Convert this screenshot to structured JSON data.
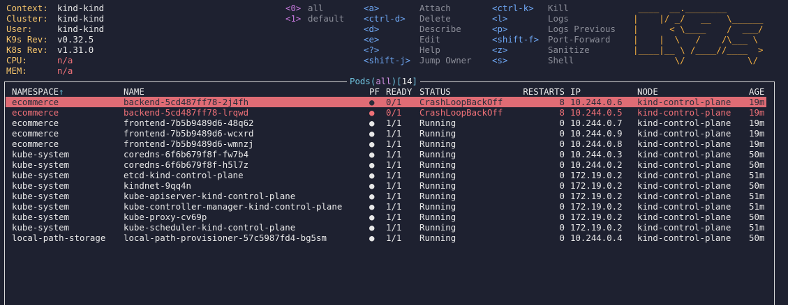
{
  "info": [
    {
      "label": "Context:",
      "value": "kind-kind"
    },
    {
      "label": "Cluster:",
      "value": "kind-kind"
    },
    {
      "label": "User:",
      "value": "kind-kind"
    },
    {
      "label": "K9s Rev:",
      "value": "v0.32.5"
    },
    {
      "label": "K8s Rev:",
      "value": "v1.31.0"
    },
    {
      "label": "CPU:",
      "value": "n/a"
    },
    {
      "label": "MEM:",
      "value": "n/a"
    }
  ],
  "namespaces": [
    {
      "key": "<0>",
      "name": "all"
    },
    {
      "key": "<1>",
      "name": "default"
    }
  ],
  "hotkeys": [
    {
      "key": "<a>",
      "action": "Attach"
    },
    {
      "key": "<ctrl-d>",
      "action": "Delete"
    },
    {
      "key": "<d>",
      "action": "Describe"
    },
    {
      "key": "<e>",
      "action": "Edit"
    },
    {
      "key": "<?>",
      "action": "Help"
    },
    {
      "key": "<shift-j>",
      "action": "Jump Owner"
    },
    {
      "key": "<ctrl-k>",
      "action": "Kill"
    },
    {
      "key": "<l>",
      "action": "Logs"
    },
    {
      "key": "<p>",
      "action": "Logs Previous"
    },
    {
      "key": "<shift-f>",
      "action": "Port-Forward"
    },
    {
      "key": "<z>",
      "action": "Sanitize"
    },
    {
      "key": "<s>",
      "action": "Shell"
    }
  ],
  "logo": [
    " ____  __.________       ",
    "|    |/ _/   __   \\______",
    "|      < \\____    /  ___/",
    "|    |  \\   /    /\\___ \\ ",
    "|____|__ \\ /____//____  >",
    "        \\/            \\/ "
  ],
  "view": {
    "resource": "Pods",
    "filter": "all",
    "count": "14"
  },
  "table": {
    "headers": {
      "namespace": "NAMESPACE",
      "sort_indicator": "↑",
      "name": "NAME",
      "pf": "PF",
      "ready": "READY",
      "status": "STATUS",
      "restarts": "RESTARTS",
      "ip": "IP",
      "node": "NODE",
      "age": "AGE"
    },
    "rows": [
      {
        "namespace": "ecommerce",
        "name": "backend-5cd487ff78-2j4fh",
        "pf": "●",
        "ready": "0/1",
        "status": "CrashLoopBackOff",
        "restarts": "8",
        "ip": "10.244.0.6",
        "node": "kind-control-plane",
        "age": "19m",
        "state": "selected"
      },
      {
        "namespace": "ecommerce",
        "name": "backend-5cd487ff78-lrqwd",
        "pf": "●",
        "ready": "0/1",
        "status": "CrashLoopBackOff",
        "restarts": "8",
        "ip": "10.244.0.5",
        "node": "kind-control-plane",
        "age": "19m",
        "state": "error"
      },
      {
        "namespace": "ecommerce",
        "name": "frontend-7b5b9489d6-48q62",
        "pf": "●",
        "ready": "1/1",
        "status": "Running",
        "restarts": "0",
        "ip": "10.244.0.7",
        "node": "kind-control-plane",
        "age": "19m",
        "state": "ok"
      },
      {
        "namespace": "ecommerce",
        "name": "frontend-7b5b9489d6-wcxrd",
        "pf": "●",
        "ready": "1/1",
        "status": "Running",
        "restarts": "0",
        "ip": "10.244.0.9",
        "node": "kind-control-plane",
        "age": "19m",
        "state": "ok"
      },
      {
        "namespace": "ecommerce",
        "name": "frontend-7b5b9489d6-wmnzj",
        "pf": "●",
        "ready": "1/1",
        "status": "Running",
        "restarts": "0",
        "ip": "10.244.0.8",
        "node": "kind-control-plane",
        "age": "19m",
        "state": "ok"
      },
      {
        "namespace": "kube-system",
        "name": "coredns-6f6b679f8f-fw7b4",
        "pf": "●",
        "ready": "1/1",
        "status": "Running",
        "restarts": "0",
        "ip": "10.244.0.3",
        "node": "kind-control-plane",
        "age": "50m",
        "state": "ok"
      },
      {
        "namespace": "kube-system",
        "name": "coredns-6f6b679f8f-h5l7z",
        "pf": "●",
        "ready": "1/1",
        "status": "Running",
        "restarts": "0",
        "ip": "10.244.0.2",
        "node": "kind-control-plane",
        "age": "50m",
        "state": "ok"
      },
      {
        "namespace": "kube-system",
        "name": "etcd-kind-control-plane",
        "pf": "●",
        "ready": "1/1",
        "status": "Running",
        "restarts": "0",
        "ip": "172.19.0.2",
        "node": "kind-control-plane",
        "age": "51m",
        "state": "ok"
      },
      {
        "namespace": "kube-system",
        "name": "kindnet-9qq4n",
        "pf": "●",
        "ready": "1/1",
        "status": "Running",
        "restarts": "0",
        "ip": "172.19.0.2",
        "node": "kind-control-plane",
        "age": "50m",
        "state": "ok"
      },
      {
        "namespace": "kube-system",
        "name": "kube-apiserver-kind-control-plane",
        "pf": "●",
        "ready": "1/1",
        "status": "Running",
        "restarts": "0",
        "ip": "172.19.0.2",
        "node": "kind-control-plane",
        "age": "51m",
        "state": "ok"
      },
      {
        "namespace": "kube-system",
        "name": "kube-controller-manager-kind-control-plane",
        "pf": "●",
        "ready": "1/1",
        "status": "Running",
        "restarts": "0",
        "ip": "172.19.0.2",
        "node": "kind-control-plane",
        "age": "51m",
        "state": "ok"
      },
      {
        "namespace": "kube-system",
        "name": "kube-proxy-cv69p",
        "pf": "●",
        "ready": "1/1",
        "status": "Running",
        "restarts": "0",
        "ip": "172.19.0.2",
        "node": "kind-control-plane",
        "age": "50m",
        "state": "ok"
      },
      {
        "namespace": "kube-system",
        "name": "kube-scheduler-kind-control-plane",
        "pf": "●",
        "ready": "1/1",
        "status": "Running",
        "restarts": "0",
        "ip": "172.19.0.2",
        "node": "kind-control-plane",
        "age": "51m",
        "state": "ok"
      },
      {
        "namespace": "local-path-storage",
        "name": "local-path-provisioner-57c5987fd4-bg5sm",
        "pf": "●",
        "ready": "1/1",
        "status": "Running",
        "restarts": "0",
        "ip": "10.244.0.4",
        "node": "kind-control-plane",
        "age": "50m",
        "state": "ok"
      }
    ]
  },
  "colors": {
    "selected_row_bg": "#e06c75",
    "error_text": "#f07178",
    "label": "#f5c46a",
    "hotkey": "#6fa8f5",
    "ns_key": "#c678dd"
  }
}
